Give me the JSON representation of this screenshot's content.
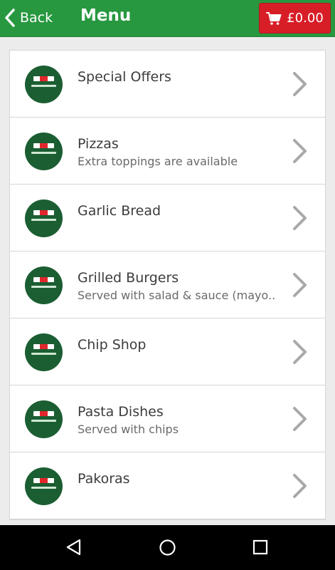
{
  "header": {
    "back_label": "Back",
    "title": "Menu",
    "cart_total": "£0.00"
  },
  "colors": {
    "header_bg": "#27983f",
    "cart_bg": "#d71e27",
    "logo_bg": "#1b5e32"
  },
  "menu": {
    "items": [
      {
        "name": "Special Offers",
        "description": ""
      },
      {
        "name": "Pizzas",
        "description": "Extra toppings are available"
      },
      {
        "name": "Garlic Bread",
        "description": ""
      },
      {
        "name": "Grilled Burgers",
        "description": "Served with salad & sauce (mayo.."
      },
      {
        "name": "Chip Shop",
        "description": ""
      },
      {
        "name": "Pasta Dishes",
        "description": "Served with chips"
      },
      {
        "name": "Pakoras",
        "description": ""
      }
    ]
  },
  "icons": {
    "back": "chevron-left-icon",
    "cart": "cart-icon",
    "row_arrow": "chevron-right-icon",
    "nav_back": "triangle-back-icon",
    "nav_home": "circle-home-icon",
    "nav_recents": "square-recents-icon"
  }
}
